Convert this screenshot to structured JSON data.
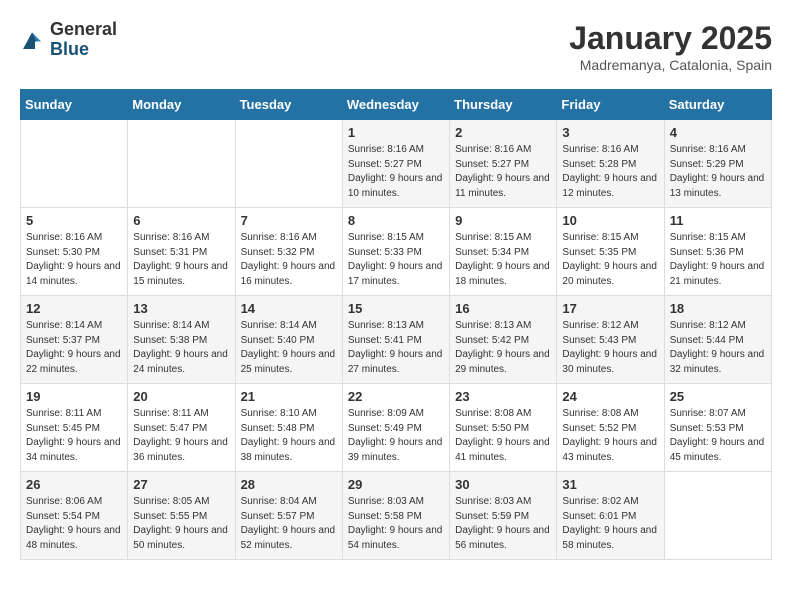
{
  "header": {
    "logo_general": "General",
    "logo_blue": "Blue",
    "month_title": "January 2025",
    "location": "Madremanya, Catalonia, Spain"
  },
  "weekdays": [
    "Sunday",
    "Monday",
    "Tuesday",
    "Wednesday",
    "Thursday",
    "Friday",
    "Saturday"
  ],
  "weeks": [
    [
      {
        "day": "",
        "sunrise": "",
        "sunset": "",
        "daylight": ""
      },
      {
        "day": "",
        "sunrise": "",
        "sunset": "",
        "daylight": ""
      },
      {
        "day": "",
        "sunrise": "",
        "sunset": "",
        "daylight": ""
      },
      {
        "day": "1",
        "sunrise": "8:16 AM",
        "sunset": "5:27 PM",
        "daylight": "9 hours and 10 minutes."
      },
      {
        "day": "2",
        "sunrise": "8:16 AM",
        "sunset": "5:27 PM",
        "daylight": "9 hours and 11 minutes."
      },
      {
        "day": "3",
        "sunrise": "8:16 AM",
        "sunset": "5:28 PM",
        "daylight": "9 hours and 12 minutes."
      },
      {
        "day": "4",
        "sunrise": "8:16 AM",
        "sunset": "5:29 PM",
        "daylight": "9 hours and 13 minutes."
      }
    ],
    [
      {
        "day": "5",
        "sunrise": "8:16 AM",
        "sunset": "5:30 PM",
        "daylight": "9 hours and 14 minutes."
      },
      {
        "day": "6",
        "sunrise": "8:16 AM",
        "sunset": "5:31 PM",
        "daylight": "9 hours and 15 minutes."
      },
      {
        "day": "7",
        "sunrise": "8:16 AM",
        "sunset": "5:32 PM",
        "daylight": "9 hours and 16 minutes."
      },
      {
        "day": "8",
        "sunrise": "8:15 AM",
        "sunset": "5:33 PM",
        "daylight": "9 hours and 17 minutes."
      },
      {
        "day": "9",
        "sunrise": "8:15 AM",
        "sunset": "5:34 PM",
        "daylight": "9 hours and 18 minutes."
      },
      {
        "day": "10",
        "sunrise": "8:15 AM",
        "sunset": "5:35 PM",
        "daylight": "9 hours and 20 minutes."
      },
      {
        "day": "11",
        "sunrise": "8:15 AM",
        "sunset": "5:36 PM",
        "daylight": "9 hours and 21 minutes."
      }
    ],
    [
      {
        "day": "12",
        "sunrise": "8:14 AM",
        "sunset": "5:37 PM",
        "daylight": "9 hours and 22 minutes."
      },
      {
        "day": "13",
        "sunrise": "8:14 AM",
        "sunset": "5:38 PM",
        "daylight": "9 hours and 24 minutes."
      },
      {
        "day": "14",
        "sunrise": "8:14 AM",
        "sunset": "5:40 PM",
        "daylight": "9 hours and 25 minutes."
      },
      {
        "day": "15",
        "sunrise": "8:13 AM",
        "sunset": "5:41 PM",
        "daylight": "9 hours and 27 minutes."
      },
      {
        "day": "16",
        "sunrise": "8:13 AM",
        "sunset": "5:42 PM",
        "daylight": "9 hours and 29 minutes."
      },
      {
        "day": "17",
        "sunrise": "8:12 AM",
        "sunset": "5:43 PM",
        "daylight": "9 hours and 30 minutes."
      },
      {
        "day": "18",
        "sunrise": "8:12 AM",
        "sunset": "5:44 PM",
        "daylight": "9 hours and 32 minutes."
      }
    ],
    [
      {
        "day": "19",
        "sunrise": "8:11 AM",
        "sunset": "5:45 PM",
        "daylight": "9 hours and 34 minutes."
      },
      {
        "day": "20",
        "sunrise": "8:11 AM",
        "sunset": "5:47 PM",
        "daylight": "9 hours and 36 minutes."
      },
      {
        "day": "21",
        "sunrise": "8:10 AM",
        "sunset": "5:48 PM",
        "daylight": "9 hours and 38 minutes."
      },
      {
        "day": "22",
        "sunrise": "8:09 AM",
        "sunset": "5:49 PM",
        "daylight": "9 hours and 39 minutes."
      },
      {
        "day": "23",
        "sunrise": "8:08 AM",
        "sunset": "5:50 PM",
        "daylight": "9 hours and 41 minutes."
      },
      {
        "day": "24",
        "sunrise": "8:08 AM",
        "sunset": "5:52 PM",
        "daylight": "9 hours and 43 minutes."
      },
      {
        "day": "25",
        "sunrise": "8:07 AM",
        "sunset": "5:53 PM",
        "daylight": "9 hours and 45 minutes."
      }
    ],
    [
      {
        "day": "26",
        "sunrise": "8:06 AM",
        "sunset": "5:54 PM",
        "daylight": "9 hours and 48 minutes."
      },
      {
        "day": "27",
        "sunrise": "8:05 AM",
        "sunset": "5:55 PM",
        "daylight": "9 hours and 50 minutes."
      },
      {
        "day": "28",
        "sunrise": "8:04 AM",
        "sunset": "5:57 PM",
        "daylight": "9 hours and 52 minutes."
      },
      {
        "day": "29",
        "sunrise": "8:03 AM",
        "sunset": "5:58 PM",
        "daylight": "9 hours and 54 minutes."
      },
      {
        "day": "30",
        "sunrise": "8:03 AM",
        "sunset": "5:59 PM",
        "daylight": "9 hours and 56 minutes."
      },
      {
        "day": "31",
        "sunrise": "8:02 AM",
        "sunset": "6:01 PM",
        "daylight": "9 hours and 58 minutes."
      },
      {
        "day": "",
        "sunrise": "",
        "sunset": "",
        "daylight": ""
      }
    ]
  ]
}
